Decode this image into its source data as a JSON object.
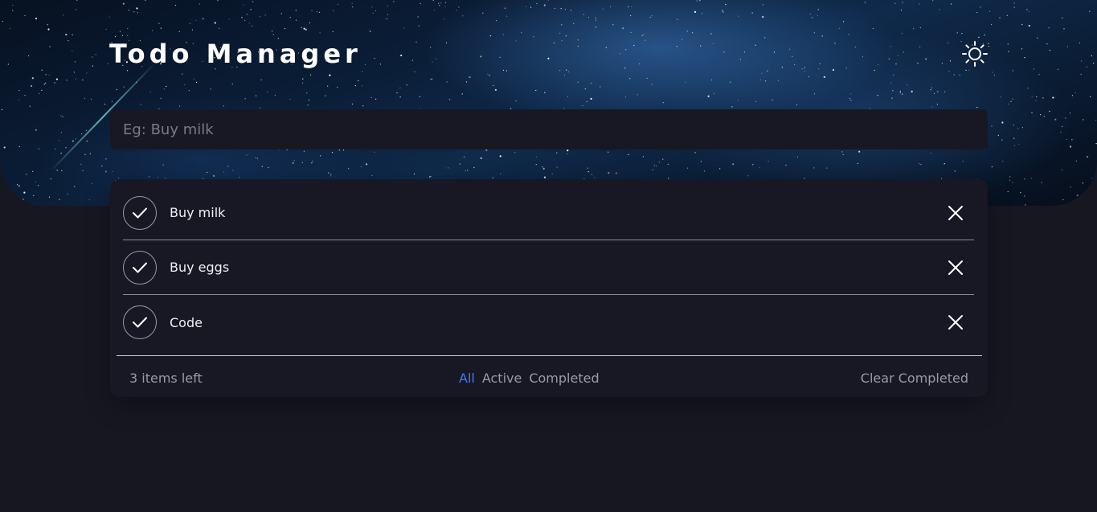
{
  "app": {
    "title": "Todo Manager"
  },
  "new_todo": {
    "placeholder": "Eg: Buy milk",
    "value": ""
  },
  "todos": [
    {
      "text": "Buy milk",
      "completed": false
    },
    {
      "text": "Buy eggs",
      "completed": false
    },
    {
      "text": "Code",
      "completed": false
    }
  ],
  "footer": {
    "items_left": "3 items left",
    "filters": [
      {
        "label": "All",
        "active": true
      },
      {
        "label": "Active",
        "active": false
      },
      {
        "label": "Completed",
        "active": false
      }
    ],
    "clear_label": "Clear Completed"
  },
  "icons": {
    "theme": "sun-icon",
    "check": "check-icon",
    "delete": "close-icon"
  },
  "colors": {
    "background": "#171722",
    "card": "#181824",
    "accent": "#3a7bfd",
    "muted_text": "#9a9aa8"
  }
}
